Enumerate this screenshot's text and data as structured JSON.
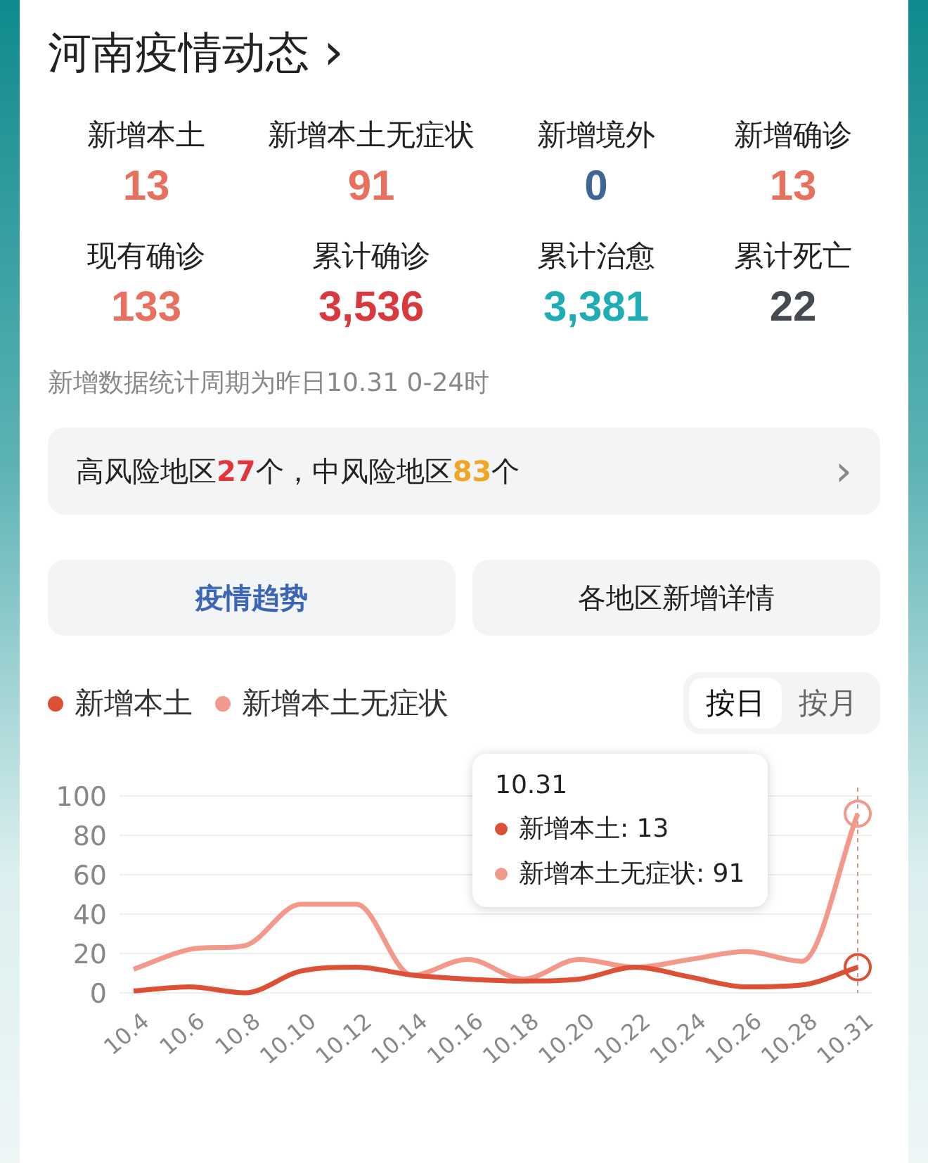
{
  "header": {
    "title": "河南疫情动态",
    "chevron": "›"
  },
  "stats": [
    {
      "label": "新增本土",
      "value": "13",
      "color": "#e8705e"
    },
    {
      "label": "新增本土无症状",
      "value": "91",
      "color": "#e8705e"
    },
    {
      "label": "新增境外",
      "value": "0",
      "color": "#3e6796"
    },
    {
      "label": "新增确诊",
      "value": "13",
      "color": "#e8705e"
    },
    {
      "label": "现有确诊",
      "value": "133",
      "color": "#e8705e"
    },
    {
      "label": "累计确诊",
      "value": "3,536",
      "color": "#d9383c"
    },
    {
      "label": "累计治愈",
      "value": "3,381",
      "color": "#1fadb5"
    },
    {
      "label": "累计死亡",
      "value": "22",
      "color": "#454a50"
    }
  ],
  "note": "新增数据统计周期为昨日10.31 0-24时",
  "risk_bar": {
    "segments": [
      {
        "text": "高风险地区"
      },
      {
        "text": "27",
        "color": "#e0363a"
      },
      {
        "text": "个，中风险地区"
      },
      {
        "text": "83",
        "color": "#f0a625"
      },
      {
        "text": "个"
      }
    ],
    "chevron": "›"
  },
  "tabs": [
    {
      "label": "疫情趋势",
      "selected": true
    },
    {
      "label": "各地区新增详情",
      "selected": false
    }
  ],
  "period_toggle": [
    {
      "label": "按日",
      "selected": true
    },
    {
      "label": "按月",
      "selected": false
    }
  ],
  "chart": {
    "chart_data": {
      "type": "line",
      "categories": [
        "10.4",
        "10.6",
        "10.8",
        "10.10",
        "10.12",
        "10.14",
        "10.16",
        "10.18",
        "10.20",
        "10.22",
        "10.24",
        "10.26",
        "10.28",
        "10.31"
      ],
      "series": [
        {
          "name": "新增本土",
          "color": "#dc5136",
          "values": [
            1,
            3,
            0,
            11,
            13,
            9,
            7,
            6,
            7,
            13,
            8,
            3,
            4,
            13
          ]
        },
        {
          "name": "新增本土无症状",
          "color": "#f2998b",
          "values": [
            12,
            22,
            24,
            45,
            45,
            9,
            17,
            7,
            17,
            13,
            17,
            21,
            16,
            91
          ]
        }
      ],
      "ylim": [
        0,
        100
      ],
      "yticks": [
        0,
        20,
        40,
        60,
        80,
        100
      ],
      "grid": true,
      "ref_lines": [
        {
          "axis": "x",
          "value": "10.31"
        }
      ]
    },
    "tooltip": {
      "title": "10.31",
      "rows": [
        {
          "text": "新增本土: 13",
          "color": "#dc5136"
        },
        {
          "text": "新增本土无症状: 91",
          "color": "#f2998b"
        }
      ]
    }
  }
}
